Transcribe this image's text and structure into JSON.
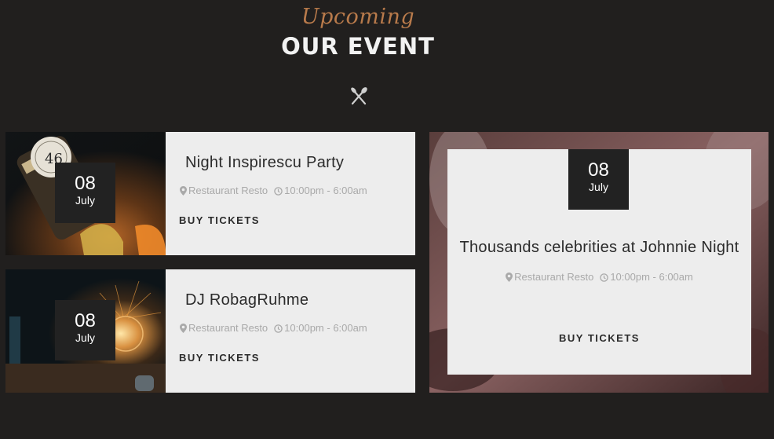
{
  "section": {
    "script_title": "Upcoming",
    "title": "OUR EVENT"
  },
  "icons": {
    "divider": "fork-knife-icon",
    "location": "map-pin-icon",
    "time": "clock-icon"
  },
  "colors": {
    "background": "#211f1e",
    "accent": "#b87a4b",
    "card": "#ededed",
    "date_box": "#222222"
  },
  "events": [
    {
      "day": "08",
      "month": "July",
      "title": "Night Inspirescu Party",
      "location": "Restaurant Resto",
      "time": "10:00pm - 6:00am",
      "cta": "BUY TICKETS"
    },
    {
      "day": "08",
      "month": "July",
      "title": "DJ RobagRuhme",
      "location": "Restaurant Resto",
      "time": "10:00pm - 6:00am",
      "cta": "BUY TICKETS"
    },
    {
      "day": "08",
      "month": "July",
      "title": "Thousands celebrities at Johnnie Night",
      "location": "Restaurant Resto",
      "time": "10:00pm - 6:00am",
      "cta": "BUY TICKETS"
    }
  ]
}
